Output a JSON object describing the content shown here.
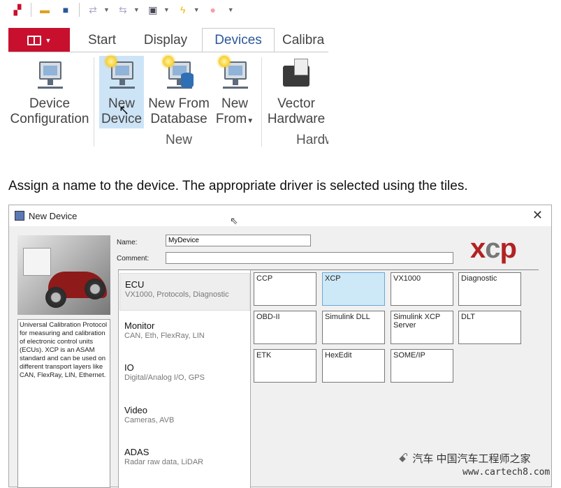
{
  "toolbar": {
    "icons": [
      "network-config-icon",
      "open-folder-icon",
      "save-icon",
      "connect-icon",
      "disconnect-icon",
      "window-layout-icon",
      "lightning-icon",
      "record-icon",
      "overflow-icon"
    ]
  },
  "ribbon": {
    "tabs": [
      "Start",
      "Display",
      "Devices",
      "Calibra"
    ],
    "active_tab": "Devices",
    "buttons": {
      "device_config": [
        "Device",
        "Configuration"
      ],
      "new_device": [
        "New",
        "Device"
      ],
      "new_from_db": [
        "New From",
        "Database"
      ],
      "new_from": [
        "New",
        "From"
      ],
      "vector_hw": [
        "Vector",
        "Hardware"
      ]
    },
    "groups": {
      "new": "New",
      "hardware": "Hardw"
    }
  },
  "caption": "Assign a name to the device. The appropriate driver is selected using the tiles.",
  "dialog": {
    "title": "New Device",
    "name_label": "Name:",
    "name_value": "MyDevice",
    "comment_label": "Comment:",
    "comment_value": "",
    "logo_text": "xcp",
    "description": "Universal Calibration Protocol for measuring and calibration of electronic control units (ECUs). XCP is an ASAM standard and can be used on different transport layers like CAN, FlexRay, LIN, Ethernet.",
    "categories": [
      {
        "title": "ECU",
        "sub": "VX1000, Protocols, Diagnostic",
        "selected": true
      },
      {
        "title": "Monitor",
        "sub": "CAN, Eth, FlexRay, LIN"
      },
      {
        "title": "IO",
        "sub": "Digital/Analog I/O, GPS"
      },
      {
        "title": "Video",
        "sub": "Cameras, AVB"
      },
      {
        "title": "ADAS",
        "sub": "Radar raw data, LiDAR"
      }
    ],
    "tiles": [
      "CCP",
      "XCP",
      "VX1000",
      "Diagnostic",
      "OBD-II",
      "Simulink DLL",
      "Simulink XCP Server",
      "DLT",
      "ETK",
      "HexEdit",
      "SOME/IP"
    ],
    "selected_tile": "XCP"
  },
  "watermark": {
    "line1": "汽车 中国汽车工程师之家",
    "line2": "www.cartech8.com"
  },
  "colors": {
    "file_tab": "#c8102e",
    "accent": "#2b579a",
    "selected_tile": "#cde8f6",
    "xcp_logo": "#b22222"
  }
}
